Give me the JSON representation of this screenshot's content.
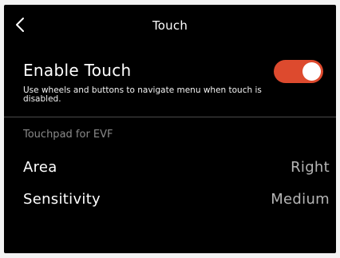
{
  "header": {
    "title": "Touch",
    "back_icon": "chevron-left-icon"
  },
  "enable_touch": {
    "label": "Enable Touch",
    "description": "Use wheels and buttons to navigate menu when touch is disabled.",
    "enabled": true,
    "accent_color": "#dd4a2e"
  },
  "touchpad": {
    "section_title": "Touchpad for EVF",
    "settings": [
      {
        "label": "Area",
        "value": "Right"
      },
      {
        "label": "Sensitivity",
        "value": "Medium"
      }
    ]
  }
}
